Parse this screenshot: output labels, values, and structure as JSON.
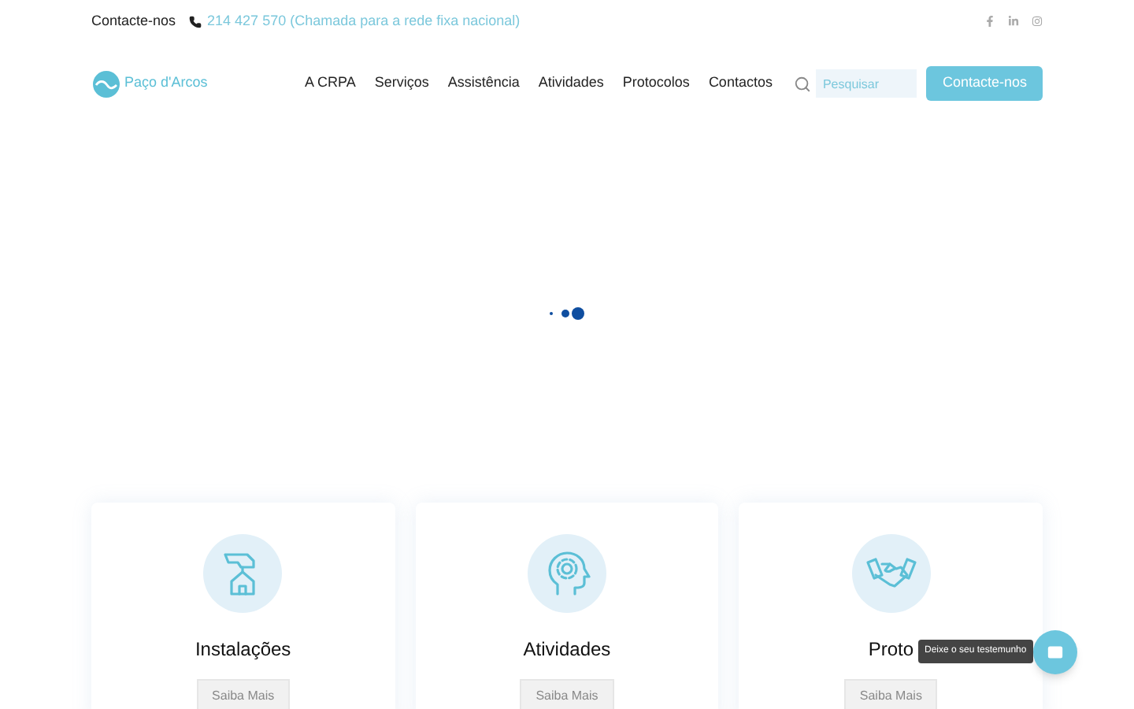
{
  "topbar": {
    "label": "Contacte-nos",
    "phone": "214 427 570 (Chamada para a rede fixa nacional)"
  },
  "logo": {
    "text": "Paço d'Arcos"
  },
  "nav": {
    "items": [
      "A CRPA",
      "Serviços",
      "Assistência",
      "Atividades",
      "Protocolos",
      "Contactos"
    ],
    "search": {
      "placeholder": "Pesquisar"
    },
    "button": "Contacte-nos"
  },
  "cards": [
    {
      "kind": "house",
      "title": "Instalações",
      "button": "Saiba Mais"
    },
    {
      "kind": "head",
      "title": "Atividades",
      "button": "Saiba Mais"
    },
    {
      "kind": "handshake",
      "title": "Proto",
      "button": "Saiba Mais"
    }
  ],
  "floating": {
    "tooltip": "Deixe o seu testemunho"
  }
}
